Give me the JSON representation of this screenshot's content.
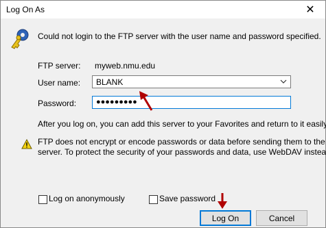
{
  "window": {
    "title": "Log On As"
  },
  "message": "Could not login to the FTP server with the user name and password specified.",
  "fields": {
    "ftp_server_label": "FTP server:",
    "ftp_server_value": "myweb.nmu.edu",
    "username_label": "User name:",
    "username_value": "BLANK",
    "password_label": "Password:",
    "password_value": "●●●●●●●●●"
  },
  "info": "After you log on, you can add this server to your Favorites and return to it easily.",
  "warning_line1": "FTP does not encrypt or encode passwords or data before sending them to the",
  "warning_line2": "server.  To protect the security of your passwords and data, use WebDAV instead.",
  "options": {
    "anonymous_label": "Log on anonymously",
    "save_password_label": "Save password"
  },
  "buttons": {
    "logon": "Log On",
    "cancel": "Cancel",
    "close": "✕"
  },
  "colors": {
    "accent": "#0078d7",
    "annotation_arrow": "#b00000",
    "warning": "#f5d40f"
  }
}
